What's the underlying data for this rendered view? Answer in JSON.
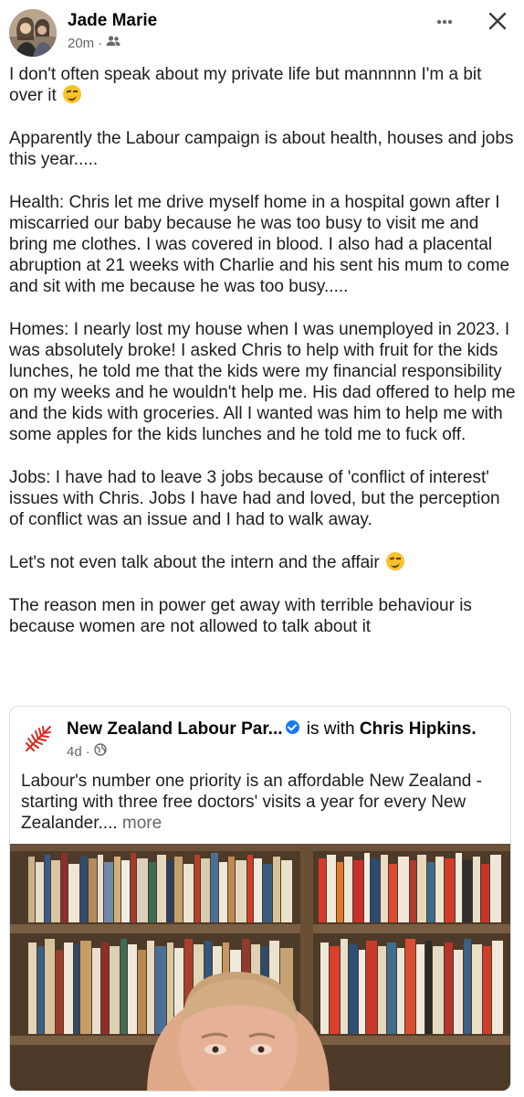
{
  "author": {
    "name": "Jade Marie",
    "time": "20m",
    "separator": "·",
    "audience_icon": "friends-icon"
  },
  "post": {
    "paragraphs": [
      "I don't often speak about my private life but mannnnn I'm a bit over it",
      "Apparently the Labour campaign is about health, houses and jobs this year.....",
      "Health: Chris let me drive myself home in a hospital gown after I miscarried our baby because he was too busy to visit me and bring me clothes. I was covered in blood. I also had a placental abruption at 21 weeks with Charlie and his sent his mum to come and sit with me because he was too busy.....",
      "Homes: I nearly lost my house when I was unemployed in 2023. I was absolutely broke! I asked Chris to help with fruit for the kids lunches, he told me that the kids were my financial responsibility on my weeks and he wouldn't help me. His dad offered to help me and the kids with groceries. All I wanted was him to help me with some apples for the kids lunches and he told me to fuck off.",
      "Jobs: I have had to leave 3 jobs because of 'conflict of interest' issues with Chris. Jobs I have had and loved, but the perception of conflict was an issue and I had to walk away.",
      "Let's not even talk about the intern and the affair",
      "The reason men in power get away with terrible behaviour is because women are not allowed to talk about it"
    ],
    "emoji_icon": "grinning-squinting-face-icon"
  },
  "shared": {
    "page_name": "New Zealand Labour Par...",
    "with_text": "is with",
    "tagged": "Chris Hipkins.",
    "time": "4d",
    "separator": "·",
    "audience_icon": "globe-icon",
    "text": "Labour's number one priority is an affordable New Zealand - starting with three free doctors' visits a year for every New Zealander....",
    "more_label": "more"
  },
  "colors": {
    "verified": "#1877f2",
    "labour_red": "#d82a20",
    "meta_gray": "#65676b"
  }
}
